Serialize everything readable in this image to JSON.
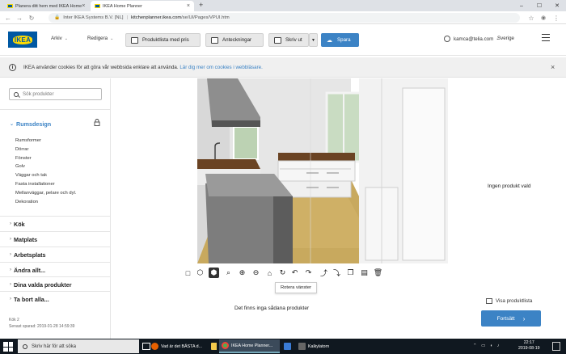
{
  "browser": {
    "tabs": [
      {
        "title": "Planera ditt hem med IKEA Home"
      },
      {
        "title": "IKEA Home Planner"
      }
    ],
    "address": {
      "org": "Inter IKEA Systems B.V. [NL]",
      "url_host": "kitchenplanner.ikea.com",
      "url_path": "/se/UI/Pages/VPUI.htm"
    }
  },
  "header": {
    "logo_text": "IKEA",
    "menu_arkiv": "Arkiv",
    "menu_redigera": "Redigera",
    "btn_produktlista": "Produktlista med pris",
    "btn_anteckningar": "Anteckningar",
    "btn_skriv": "Skriv ut",
    "btn_spara": "Spara",
    "user_email": "kamca@telia.com",
    "country": "Sverige"
  },
  "cookie": {
    "text": "IKEA använder cookies för att göra vår webbsida enklare att använda.",
    "link": "Lär dig mer om cookies i webbläsare."
  },
  "sidebar": {
    "search_placeholder": "Sök produkter",
    "section_title": "Rumsdesign",
    "subitems": [
      "Rumsformer",
      "Dörrar",
      "Fönster",
      "Golv",
      "Väggar och tak",
      "Fasta installationer",
      "Mellanväggar, pelare och dyl.",
      "Dekoration"
    ],
    "categories": [
      "Kök",
      "Matplats",
      "Arbetsplats",
      "Ändra allt...",
      "Dina valda produkter",
      "Ta bort alla..."
    ],
    "footer_kitchen": "Kök 2",
    "footer_saved": "Senast sparad: 2019-01-28 14:59:39"
  },
  "center": {
    "tooltip": "Rotera vänster",
    "no_products": "Det finns inga sådana produkter"
  },
  "right": {
    "no_product_selected": "Ingen produkt vald",
    "show_list": "Visa produktlista",
    "continue": "Fortsätt"
  },
  "taskbar": {
    "search": "Skriv här för att söka",
    "items": [
      "Vad är det BÄSTA d...",
      "IKEA Home Planner...",
      "Kalkylatorn"
    ],
    "time": "22:17",
    "date": "2019-08-19"
  },
  "colors": {
    "accent": "#3c83c5",
    "ikea_blue": "#0058a3",
    "ikea_yellow": "#ffdb00"
  }
}
